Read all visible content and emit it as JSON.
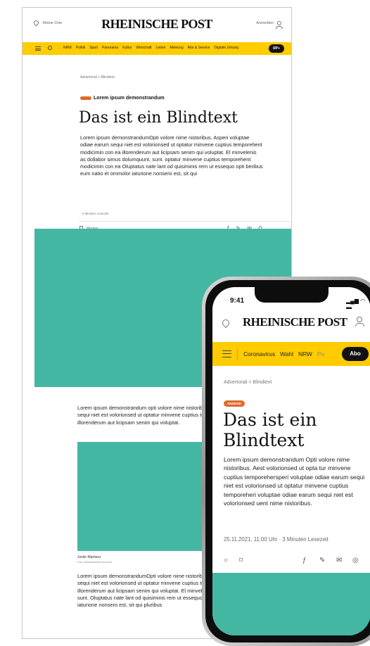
{
  "desktop": {
    "location": "Meine Orte",
    "logo": "RHEINISCHE POST",
    "login": "Anmelden",
    "nav_items": [
      "NRW",
      "Politik",
      "Sport",
      "Panorama",
      "Kultur",
      "Wirtschaft",
      "Leben",
      "Meinung",
      "Abo & Service",
      "Digitale Zeitung"
    ],
    "abo": "RP+",
    "breadcrumb": "Advertorial  >  Blindtext",
    "kicker": "Lorem ipsum demonstrandum",
    "title": "Das ist ein Blindtext",
    "body": "Lorem ipsum demonstrandumOpti volore nime nistoribus. Asperi voluptae odiae earum sequi niet est volorionsed ut optatur minvene cuptius temporehent modicimin con ea illorenderum aut licipsam senim qui voluptat. El minvelenis as dollabor simus dolumquunt, sunt. optatur minvene cuptius temporehent modicimin con ea Oluptatus nate lant od quisiminis rem ut essequo opti beribus eum natio et ommolor iaturione nonsero est, sit qui",
    "read_time": "· 2 Minuten Lesezeit",
    "bookmark": "Merken",
    "body2": "Lorem ipsum demonstrandum opti volore nime nistoribus. Asperi voluptae odiae earum sequi niet est volorionsed ut optatur minvene cuptius temporehent.modicimin con ea illorenderum aut licipsam senim qui voluptat.",
    "caption": "Jonile Martinez",
    "caption_credit": "Foto: Mmofloriasdmeu Honoriia",
    "body3": "Lorem ipsum demonstrandumOpti volore nime nistoribus. Asperi voluptae odiae earum sequi niet est volorionsed ut optatur minvene cuptius temporehent.modicimin con ea illorenderum aut licipsam senim qui voluptat. El minvelenis as dollabor simus dolumquunt, sunt. Oluptatus nate lant od quisiminis rem ut essequo opti beribus eum natio et ommolor iaturione nonsero est, sit qui pluribus"
  },
  "phone": {
    "time": "9:41",
    "logo": "RHEINISCHE POST",
    "nav_items": [
      "Coronavirus",
      "Wahl",
      "NRW",
      "Po"
    ],
    "abo": "Abo",
    "breadcrumb": "Advertorial  >  Blindtext",
    "badge": "ANZEIGE",
    "title": "Das ist ein Blindtext",
    "body": "Lorem ipsum demonstrandum Opti volore nime nistoribus. Aest volorionsed ut opta tur minvene cuptius temporehersperi voluptae odiae earum sequi niet est volorionsed ut optatur minvene cuptius temporeheri voluptae odiae earum sequi niet est volorionsed uent nime nistoribus.",
    "meta": "25.11.2021, 11:00 Uhr · 3 Minuten Lesezeit"
  },
  "colors": {
    "brand_yellow": "#ffcc00",
    "teal_image": "#44b7a3",
    "badge_orange": "#e06a2a"
  }
}
